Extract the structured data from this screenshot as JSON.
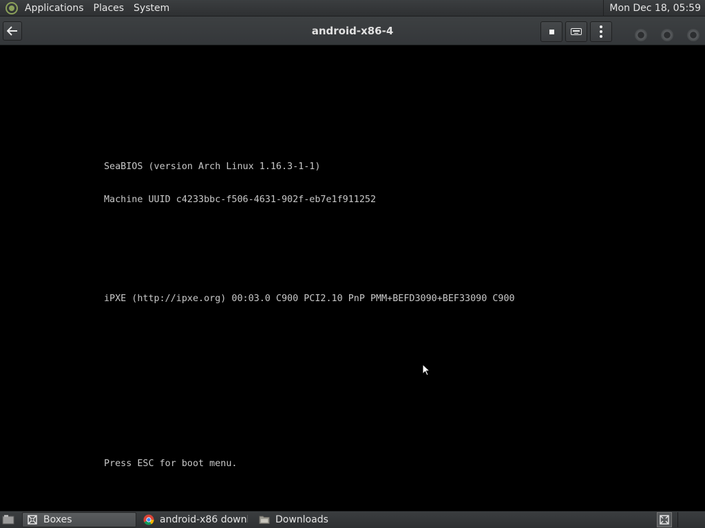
{
  "top_panel": {
    "menus": [
      "Applications",
      "Places",
      "System"
    ],
    "clock": "Mon Dec 18, 05:59"
  },
  "headerbar": {
    "title": "android-x86-4"
  },
  "console": {
    "lines": [
      "SeaBIOS (version Arch Linux 1.16.3-1-1)",
      "Machine UUID c4233bbc-f506-4631-902f-eb7e1f911252",
      "",
      "",
      "iPXE (http://ipxe.org) 00:03.0 C900 PCI2.10 PnP PMM+BEFD3090+BEF33090 C900",
      "",
      "",
      "",
      "",
      "Press ESC for boot menu."
    ]
  },
  "taskbar": {
    "tasks": [
      {
        "label": "Boxes",
        "icon": "boxes-icon"
      },
      {
        "label": "android-x86 downl...",
        "icon": "chrome-icon"
      },
      {
        "label": "Downloads",
        "icon": "folder-icon"
      }
    ]
  },
  "colors": {
    "panel_bg": "#34373a",
    "console_text": "#c8c8c8",
    "menu_logo": "#8ba15a"
  }
}
